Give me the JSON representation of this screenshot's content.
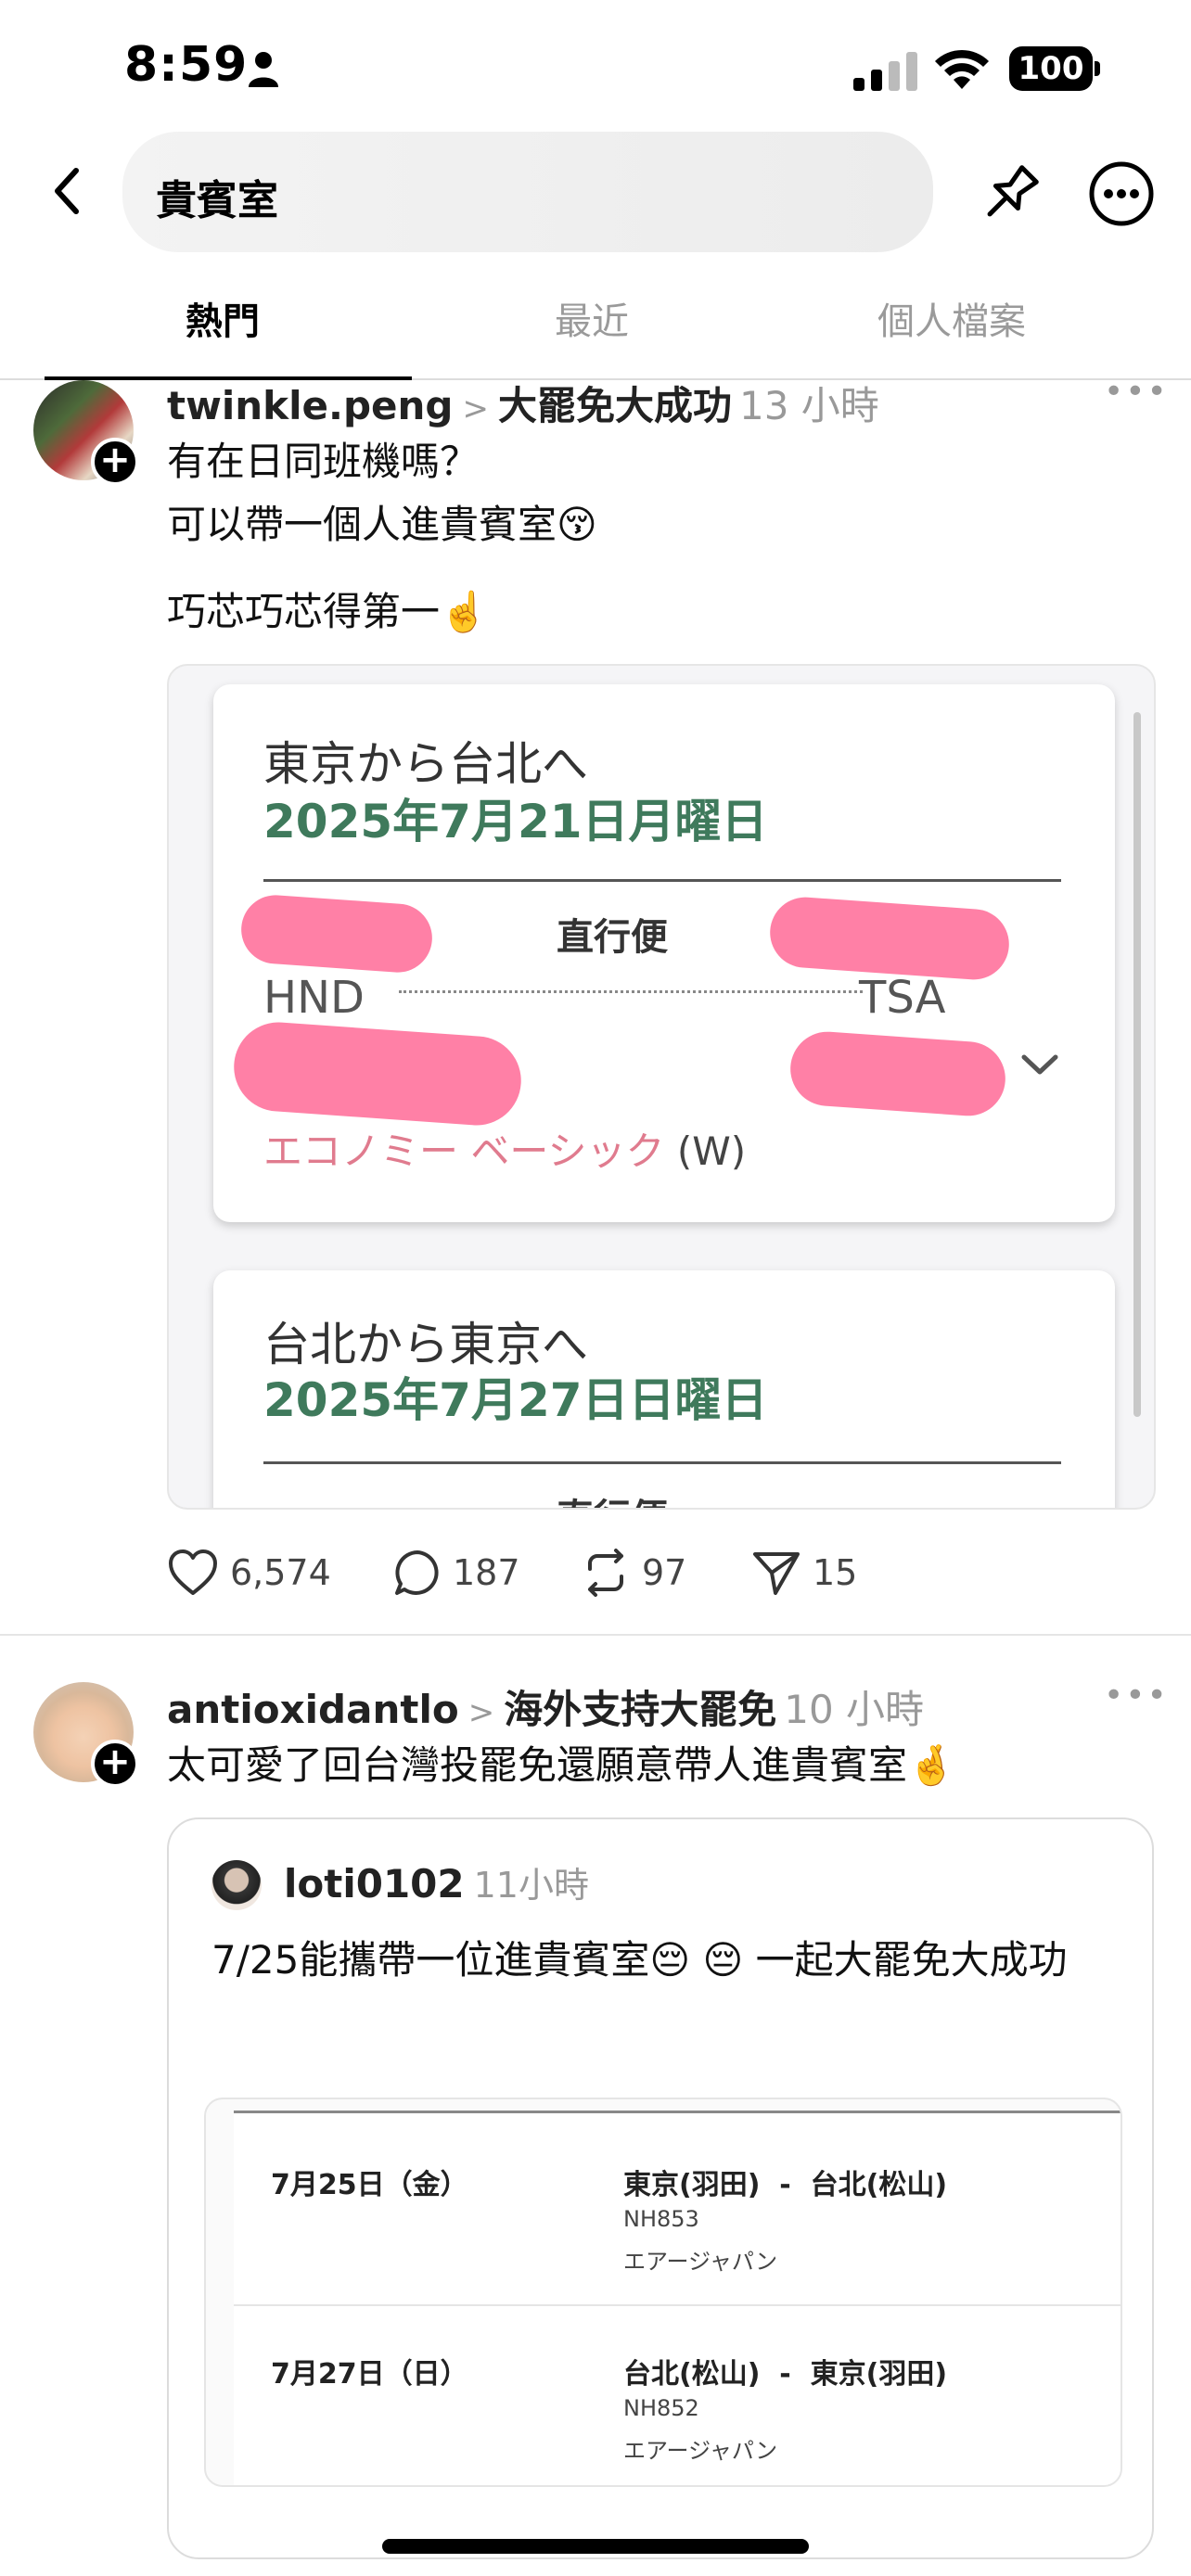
{
  "status_bar": {
    "time": "8:59",
    "battery": "100"
  },
  "header": {
    "search_query": "貴賓室"
  },
  "tabs": [
    {
      "label": "熱門",
      "active": true
    },
    {
      "label": "最近",
      "active": false
    },
    {
      "label": "個人檔案",
      "active": false
    }
  ],
  "post1": {
    "username": "twinkle.peng",
    "topic": "大罷免大成功",
    "time": "13 小時",
    "lines": [
      "有在日同班機嗎？",
      "可以帶一個人進貴賓室😚",
      "巧芯巧芯得第一☝️"
    ],
    "card1": {
      "route": "東京から台北へ",
      "date": "2025年7月21日月曜日",
      "direct": "直行便",
      "from_code": "HND",
      "to_code": "TSA",
      "fare": "エコノミー ベーシック",
      "fare_class": "(W)"
    },
    "card2": {
      "route": "台北から東京へ",
      "date": "2025年7月27日日曜日",
      "direct": "直行便"
    },
    "stats": {
      "likes": "6,574",
      "comments": "187",
      "reposts": "97",
      "shares": "15"
    }
  },
  "post2": {
    "username": "antioxidantlo",
    "topic": "海外支持大罷免",
    "time": "10 小時",
    "text": "太可愛了回台灣投罷免還願意帶人進貴賓室🤞",
    "quote": {
      "username": "loti0102",
      "time": "11小時",
      "text": "7/25能攜帶一位進貴賓室😔 😔 一起大罷免大成功",
      "rows": [
        {
          "date": "7月25日（金）",
          "route": "東京(羽田)  -  台北(松山)",
          "flight": "NH853",
          "airline": "エアージャパン"
        },
        {
          "date": "7月27日（日）",
          "route": "台北(松山)  -  東京(羽田)",
          "flight": "NH852",
          "airline": "エアージャパン"
        }
      ]
    }
  }
}
